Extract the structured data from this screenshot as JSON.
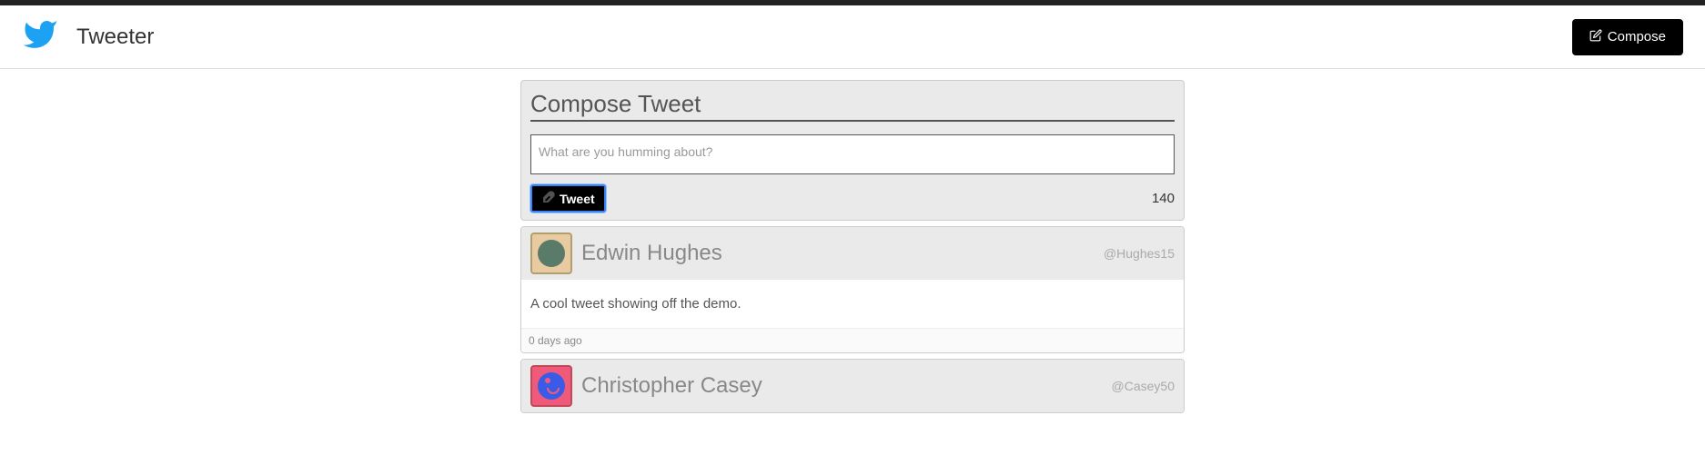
{
  "app": {
    "title": "Tweeter"
  },
  "nav": {
    "compose_button": "Compose"
  },
  "compose": {
    "heading": "Compose Tweet",
    "placeholder": "What are you humming about?",
    "value": "",
    "submit_label": "Tweet",
    "char_count": "140"
  },
  "tweets": [
    {
      "name": "Edwin Hughes",
      "handle": "@Hughes15",
      "body": "A cool tweet showing off the demo.",
      "time": "0 days ago"
    },
    {
      "name": "Christopher Casey",
      "handle": "@Casey50",
      "body": "",
      "time": ""
    }
  ]
}
